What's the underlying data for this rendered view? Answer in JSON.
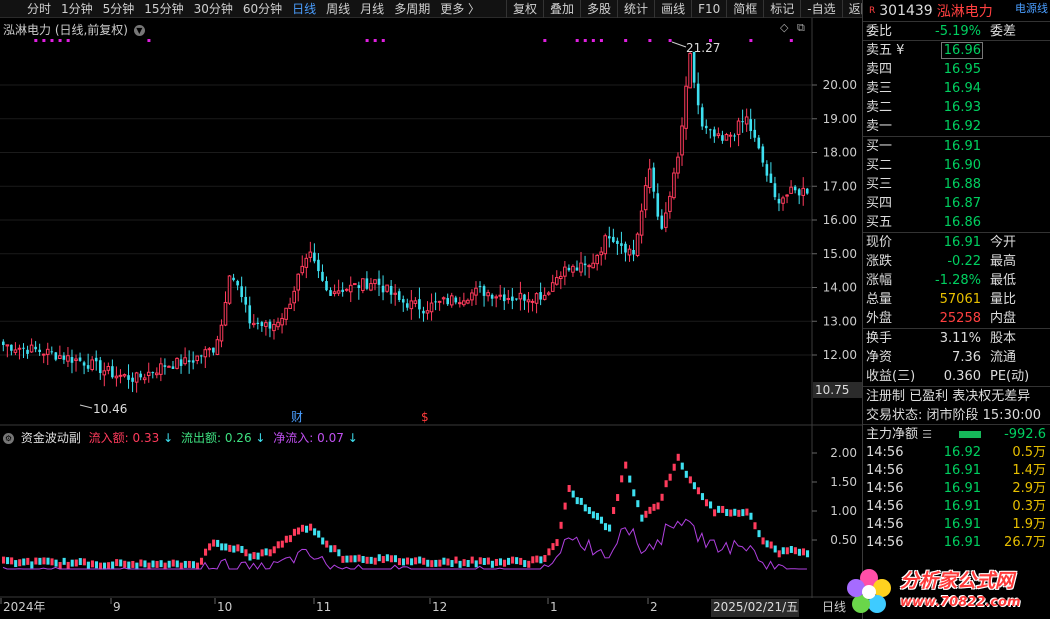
{
  "toolbar": {
    "periods": [
      "分时",
      "1分钟",
      "5分钟",
      "15分钟",
      "30分钟",
      "60分钟",
      "日线",
      "周线",
      "月线",
      "多周期",
      "更多 〉"
    ],
    "active_period": "日线",
    "tools": [
      "复权",
      "叠加",
      "多股",
      "统计",
      "画线",
      "F10",
      "简框",
      "标记",
      "-自选",
      "返回"
    ]
  },
  "chart": {
    "title": "泓淋电力 (日线,前复权)",
    "high_label": "21.27",
    "low_label": "10.46",
    "price_ticks": [
      "20.00",
      "19.00",
      "18.00",
      "17.00",
      "16.00",
      "15.00",
      "14.00",
      "13.00",
      "12.00"
    ],
    "cursor_price": "10.75",
    "event_markers": [
      "财",
      "$"
    ],
    "date_ticks": [
      "2024年",
      "9",
      "10",
      "11",
      "12",
      "1",
      "2"
    ],
    "cursor_date": "2025/02/21/五",
    "right_corner_label": "日线"
  },
  "indicator": {
    "name": "资金波动副",
    "inflow_label": "流入额:",
    "inflow_value": "0.33",
    "outflow_label": "流出额:",
    "outflow_value": "0.26",
    "net_label": "净流入:",
    "net_value": "0.07",
    "arrow": "↓",
    "ticks": [
      "2.00",
      "1.50",
      "1.00",
      "0.50"
    ]
  },
  "colors": {
    "up": "#ff3b5c",
    "down": "#3ee0f0",
    "net_line": "#b040e0",
    "marker": "#e020e0"
  },
  "quote": {
    "code": "301439",
    "name": "泓淋电力",
    "badge": "R",
    "sector_tag": "电源线",
    "webi_label": "委比",
    "webi_value": "-5.19%",
    "weicha_label": "委差",
    "asks": [
      {
        "label": "卖五 ¥",
        "price": "16.96"
      },
      {
        "label": "卖四",
        "price": "16.95"
      },
      {
        "label": "卖三",
        "price": "16.94"
      },
      {
        "label": "卖二",
        "price": "16.93"
      },
      {
        "label": "卖一",
        "price": "16.92"
      }
    ],
    "bids": [
      {
        "label": "买一",
        "price": "16.91"
      },
      {
        "label": "买二",
        "price": "16.90"
      },
      {
        "label": "买三",
        "price": "16.88"
      },
      {
        "label": "买四",
        "price": "16.87"
      },
      {
        "label": "买五",
        "price": "16.86"
      }
    ],
    "stats": [
      {
        "l1": "现价",
        "v1": "16.91",
        "c1": "green",
        "l2": "今开"
      },
      {
        "l1": "涨跌",
        "v1": "-0.22",
        "c1": "green",
        "l2": "最高"
      },
      {
        "l1": "涨幅",
        "v1": "-1.28%",
        "c1": "green",
        "l2": "最低"
      },
      {
        "l1": "总量",
        "v1": "57061",
        "c1": "yellow",
        "l2": "量比"
      },
      {
        "l1": "外盘",
        "v1": "25258",
        "c1": "red",
        "l2": "内盘"
      }
    ],
    "stats2": [
      {
        "l1": "换手",
        "v1": "3.11%",
        "l2": "股本"
      },
      {
        "l1": "净资",
        "v1": "7.36",
        "l2": "流通"
      },
      {
        "l1": "收益(三)",
        "v1": "0.360",
        "l2": "PE(动)"
      }
    ],
    "info_line1": "注册制  已盈利  表决权无差异",
    "info_line2": "交易状态: 闭市阶段 15:30:00",
    "main_net_label": "主力净额",
    "main_net_value": "-992.6",
    "ticks": [
      {
        "time": "14:56",
        "price": "16.92",
        "vol": "0.5万"
      },
      {
        "time": "14:56",
        "price": "16.91",
        "vol": "1.4万"
      },
      {
        "time": "14:56",
        "price": "16.91",
        "vol": "2.9万"
      },
      {
        "time": "14:56",
        "price": "16.91",
        "vol": "0.3万"
      },
      {
        "time": "14:56",
        "price": "16.91",
        "vol": "1.9万"
      },
      {
        "time": "14:56",
        "price": "16.91",
        "vol": "26.7万"
      }
    ]
  },
  "watermark": {
    "title": "分析家公式网",
    "url": "www.70822.com"
  }
}
